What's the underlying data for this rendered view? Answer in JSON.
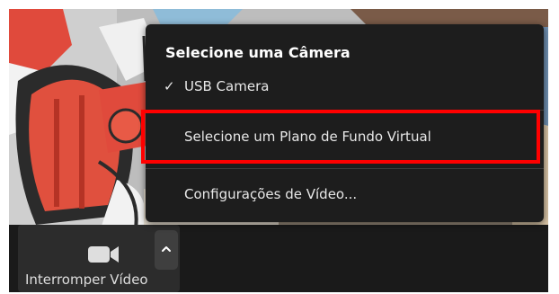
{
  "menu": {
    "heading": "Selecione uma Câmera",
    "items": [
      {
        "label": "USB Camera",
        "checked": true
      },
      {
        "label": "Selecione um Plano de Fundo Virtual",
        "checked": false
      },
      {
        "label": "Configurações de Vídeo...",
        "checked": false
      }
    ],
    "check_glyph": "✓"
  },
  "toolbar": {
    "video_label": "Interromper Vídeo",
    "video_icon": "video-camera-icon",
    "caret_icon": "chevron-up-icon"
  },
  "colors": {
    "menu_bg": "#1d1d1d",
    "toolbar_bg": "#1a1a1a",
    "highlight": "#ff0000"
  }
}
